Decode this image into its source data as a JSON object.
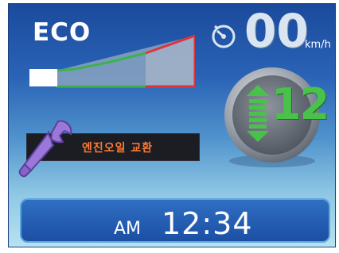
{
  "eco": {
    "label": "ECO",
    "indicator_level": 0.15
  },
  "speed": {
    "value": "00",
    "unit": "km/h"
  },
  "gear": {
    "number": "12"
  },
  "warning": {
    "message": "엔진오일 교환"
  },
  "clock": {
    "ampm": "AM",
    "time": "12:34"
  },
  "icons": {
    "speed": "speedometer-icon",
    "gear_arrows": "up-down-arrows-icon",
    "wrench": "wrench-icon"
  },
  "colors": {
    "gear_digit": "#49c24b",
    "warning_text": "#ff7b35",
    "eco_line_green": "#3db24a",
    "eco_line_red": "#e0343a"
  }
}
